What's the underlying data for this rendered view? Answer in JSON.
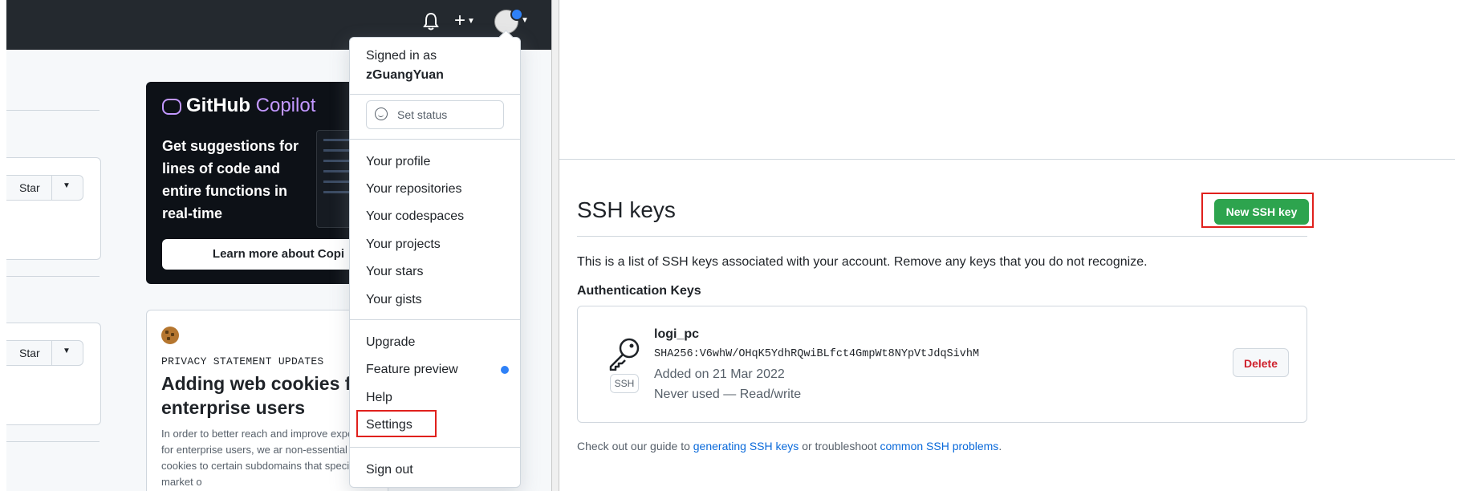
{
  "left": {
    "star_label": "Star",
    "copilot": {
      "brand_github": "GitHub",
      "brand_copilot": "Copilot",
      "pitch": "Get suggestions for lines of code and entire functions in real-time",
      "learn_more": "Learn more about Copi"
    },
    "privacy": {
      "eyebrow": "PRIVACY STATEMENT UPDATES",
      "headline": "Adding web cookies f enterprise users",
      "body": "In order to better reach and improve experience for enterprise users, we ar non-essential web cookies to certain subdomains that specifically market o"
    }
  },
  "user_menu": {
    "signed_in_as": "Signed in as",
    "username": "zGuangYuan",
    "set_status": "Set status",
    "items_group1": [
      "Your profile",
      "Your repositories",
      "Your codespaces",
      "Your projects",
      "Your stars",
      "Your gists"
    ],
    "items_group2": [
      "Upgrade",
      "Feature preview",
      "Help",
      "Settings"
    ],
    "sign_out": "Sign out",
    "highlight_color": "#e0201c"
  },
  "ssh": {
    "title": "SSH keys",
    "new_button": "New SSH key",
    "description": "This is a list of SSH keys associated with your account. Remove any keys that you do not recognize.",
    "auth_heading": "Authentication Keys",
    "key": {
      "name": "logi_pc",
      "fingerprint": "SHA256:V6whW/OHqK5YdhRQwiBLfct4GmpWt8NYpVtJdqSivhM",
      "added": "Added on 21 Mar 2022",
      "usage": "Never used — Read/write",
      "badge": "SSH",
      "delete_label": "Delete"
    },
    "guide_prefix": "Check out our guide to",
    "guide_link1": "generating SSH keys",
    "guide_middle": "or troubleshoot",
    "guide_link2": "common SSH problems",
    "guide_suffix": "."
  },
  "colors": {
    "header_bg": "#24292f",
    "primary_green": "#2da44e",
    "danger_red": "#cf222e",
    "link_blue": "#0969da",
    "annotation_red": "#e0201c"
  }
}
